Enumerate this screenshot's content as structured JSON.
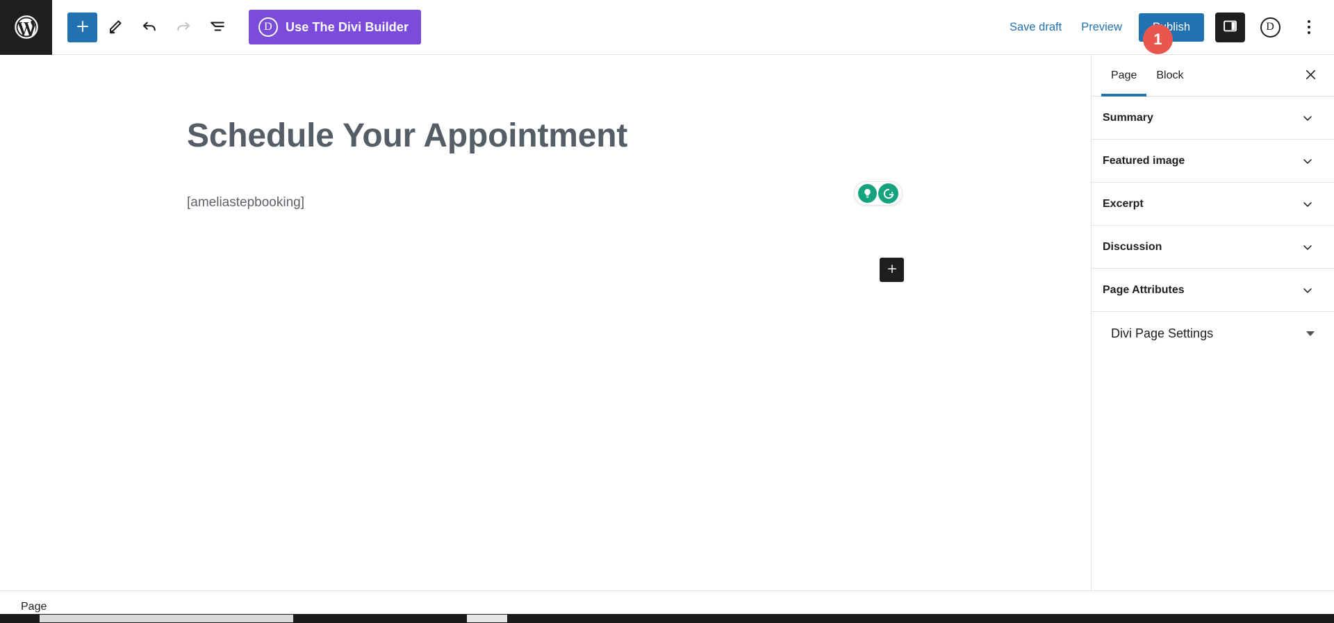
{
  "app": {
    "title": "WordPress Block Editor"
  },
  "topbar": {
    "wp_logo_icon": "wordpress-logo-icon",
    "tools": [
      {
        "name": "block-inserter-button",
        "icon": "plus-icon",
        "label": "Toggle block inserter",
        "state": "active"
      },
      {
        "name": "edit-tool-button",
        "icon": "pencil-icon",
        "label": "Tools",
        "state": "default"
      },
      {
        "name": "undo-button",
        "icon": "undo-arrow-icon",
        "label": "Undo",
        "state": "default"
      },
      {
        "name": "redo-button",
        "icon": "redo-arrow-icon",
        "label": "Redo",
        "state": "disabled"
      },
      {
        "name": "list-view-button",
        "icon": "document-outline-icon",
        "label": "Details",
        "state": "default"
      }
    ],
    "divi_builder": {
      "label": "Use The Divi Builder",
      "icon_letter": "D",
      "color": "#7b4cdb"
    },
    "save_draft_label": "Save draft",
    "preview_label": "Preview",
    "publish_label": "Publish",
    "publish_color": "#2271b1",
    "notification_badge": {
      "count": "1",
      "color": "#e8564f"
    },
    "sidebar_toggle": {
      "icon": "settings-panel-icon",
      "label": "Settings",
      "state": "active"
    },
    "divi_icon": {
      "icon": "divi-circle-icon",
      "letter": "D",
      "label": "Divi"
    },
    "options_menu": {
      "icon": "kebab-vertical-icon",
      "label": "Options"
    }
  },
  "editor": {
    "post_title": "Schedule Your Appointment",
    "blocks": [
      {
        "type": "shortcode",
        "content": "[ameliastepbooking]"
      }
    ],
    "appender": {
      "icon": "plus-icon",
      "label": "Add block"
    },
    "grammarly": {
      "bulb_icon": "lightbulb-icon",
      "logo_icon": "grammarly-g-icon",
      "color": "#15a37f"
    }
  },
  "sidebar": {
    "tabs": [
      {
        "label": "Page",
        "active": true
      },
      {
        "label": "Block",
        "active": false
      }
    ],
    "close_icon": "close-icon",
    "accent_color": "#2271b1",
    "panels": [
      {
        "label": "Summary",
        "icon": "chevron-down-icon"
      },
      {
        "label": "Featured image",
        "icon": "chevron-down-icon"
      },
      {
        "label": "Excerpt",
        "icon": "chevron-down-icon"
      },
      {
        "label": "Discussion",
        "icon": "chevron-down-icon"
      },
      {
        "label": "Page Attributes",
        "icon": "chevron-down-icon"
      }
    ],
    "divi_panel": {
      "label": "Divi Page Settings",
      "icon": "triangle-down-icon"
    }
  },
  "bottombar": {
    "breadcrumb": [
      {
        "label": "Page"
      }
    ]
  }
}
